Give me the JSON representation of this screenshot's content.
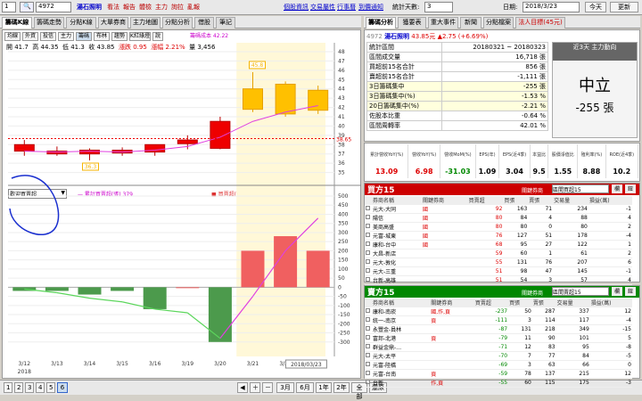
{
  "toolbar": {
    "period_value": "1",
    "stock_input": "4972",
    "stock_name": "湯石照明",
    "menu": [
      "看法",
      "報告",
      "體檢",
      "主力",
      "詢拉",
      "亂報"
    ],
    "links": [
      "個股資訊",
      "交易屬性",
      "行事曆",
      "到價通知"
    ],
    "stat_days_label": "統計天數:",
    "stat_days_value": "3",
    "date_label": "日期:",
    "date_value": "2018/3/23",
    "today_btn": "今天",
    "refresh_btn": "更新"
  },
  "left_tabs": [
    "籌碼K線",
    "籌碼走勢",
    "分點K線",
    "大單券商",
    "主力地圖",
    "分點分析",
    "借股",
    "筆記"
  ],
  "right_tabs": [
    "籌碼分析",
    "獲要表",
    "重大事件",
    "新聞",
    "分點檔案",
    "法人目標(45元)"
  ],
  "kline": {
    "buttons": [
      "均線",
      "外資",
      "投信",
      "主力",
      "籌碼",
      "布林",
      "趨勢",
      "K紅綠燈",
      "說"
    ],
    "cost_label": "籌碼成本 42.22",
    "ohlc": {
      "open": "開 41.7",
      "high": "高 44.35",
      "low": "低 41.3",
      "close": "收 43.85",
      "chg": "漲跌 0.95",
      "pct": "漲幅 2.21%",
      "vol": "量 3,456"
    },
    "price_label": "38.65",
    "tag_high": "45.8",
    "tag_low": "36.3"
  },
  "sub": {
    "selector": "歡迎買賣超",
    "legend1": "— 累計買賣超(張) 379",
    "legend2": "■ 買賣超(張) 255"
  },
  "chart_data": [
    {
      "type": "candlestick",
      "x": [
        "3/12",
        "3/13",
        "3/14",
        "3/15",
        "3/16",
        "3/19",
        "3/20",
        "3/21",
        "3/22",
        "3/23"
      ],
      "open": [
        38.0,
        37.3,
        37.0,
        37.4,
        37.2,
        38.1,
        40.5,
        44.0,
        44.5,
        41.7
      ],
      "high": [
        38.5,
        37.8,
        37.6,
        37.7,
        37.9,
        39.0,
        41.0,
        45.8,
        44.8,
        44.35
      ],
      "low": [
        36.8,
        36.8,
        36.3,
        36.8,
        36.8,
        37.5,
        37.5,
        41.5,
        41.0,
        41.3
      ],
      "close": [
        37.3,
        37.0,
        37.4,
        37.1,
        38.0,
        38.5,
        37.6,
        41.8,
        41.3,
        43.85
      ],
      "line": [
        37.3,
        37.2,
        37.3,
        37.2,
        37.4,
        37.8,
        38.8,
        40.5,
        41.5,
        42.2
      ],
      "ylim": [
        34,
        48
      ]
    },
    {
      "type": "bar",
      "x": [
        "3/12",
        "3/13",
        "3/14",
        "3/15",
        "3/16",
        "3/19",
        "3/20",
        "3/21",
        "3/22",
        "3/23"
      ],
      "values": [
        -20,
        -20,
        -40,
        -20,
        -120,
        0,
        -300,
        200,
        280,
        200
      ],
      "cumulative": [
        -10,
        -30,
        -60,
        -80,
        -120,
        -140,
        -280,
        -50,
        200,
        379
      ],
      "ylim": [
        -350,
        500
      ]
    }
  ],
  "xaxis": {
    "ticks": [
      "3/12",
      "3/13",
      "3/14",
      "3/15",
      "3/16",
      "3/19",
      "3/20",
      "3/21",
      "3/22"
    ],
    "sub": "2018",
    "cursor": "2018/03/23"
  },
  "kyticks": [
    "48",
    "47",
    "46",
    "45",
    "44",
    "43",
    "42",
    "41",
    "40",
    "39",
    "38",
    "37",
    "36",
    "35"
  ],
  "syticks": [
    "500",
    "450",
    "400",
    "350",
    "300",
    "250",
    "200",
    "150",
    "100",
    "50",
    "0",
    "-50",
    "-100",
    "-150",
    "-200",
    "-250",
    "-300"
  ],
  "bottom": {
    "pages": [
      "1",
      "2",
      "3",
      "4",
      "5",
      "6"
    ],
    "zoom": [
      "3月",
      "6月",
      "1年",
      "2年",
      "全部"
    ],
    "ok": "還原"
  },
  "stock": {
    "code": "4972",
    "name": "湯石照明",
    "price": "43.85元",
    "chg": "▲2.75 (+6.69%)"
  },
  "summary": {
    "rows": [
      [
        "統計區間",
        "20180321 ~ 20180323"
      ],
      [
        "區間成交量",
        "16,718 張"
      ],
      [
        "買超前15名合計",
        "856 張"
      ],
      [
        "賣超前15名合計",
        "-1,111 張"
      ],
      [
        "3日籌碼集中",
        "-255 張"
      ],
      [
        "3日籌碼集中(%)",
        "-1.53 %"
      ],
      [
        "20日籌碼集中(%)",
        "-2.21 %"
      ],
      [
        "佐股本比重",
        "-0.64 %"
      ],
      [
        "區間周轉率",
        "42.01 %"
      ]
    ],
    "side_title": "近3天 主力動向",
    "side_value": "中立",
    "side_num": "-255 張"
  },
  "stats": {
    "headers": [
      "累計營收YoY(%)",
      "營收YoY(%)",
      "營收MoM(%)",
      "EPS(年)",
      "EPS(近4季)",
      "本益比",
      "股價淨值比",
      "殖利率(%)",
      "ROE(近4季)"
    ],
    "values": [
      "13.09",
      "6.98",
      "-31.03",
      "1.09",
      "3.04",
      "9.5",
      "1.55",
      "8.88",
      "10.2"
    ]
  },
  "buy": {
    "title": "買方15",
    "filter": "關鍵券商",
    "select": "區間買超15",
    "btn1": "欄",
    "btn2": "鈕",
    "cols": [
      "券商名稱",
      "關鍵券商",
      "買賣超",
      "買張",
      "賣張",
      "交易量",
      "損益(萬)"
    ],
    "rows": [
      [
        "元大-大同",
        "國",
        "92",
        "163",
        "71",
        "234",
        "-1"
      ],
      [
        "陽信",
        "國",
        "80",
        "84",
        "4",
        "88",
        "4"
      ],
      [
        "美商高盛",
        "國",
        "80",
        "80",
        "0",
        "80",
        "2"
      ],
      [
        "元富-城東",
        "國",
        "76",
        "127",
        "51",
        "178",
        "-4"
      ],
      [
        "康和-台中",
        "國",
        "68",
        "95",
        "27",
        "122",
        "1"
      ],
      [
        "大昌-新店",
        "",
        "59",
        "60",
        "1",
        "61",
        "2"
      ],
      [
        "元大-敦化",
        "",
        "55",
        "131",
        "76",
        "207",
        "6"
      ],
      [
        "元大-三重",
        "",
        "51",
        "98",
        "47",
        "145",
        "-1"
      ],
      [
        "台新-高雄",
        "",
        "51",
        "54",
        "3",
        "57",
        "4"
      ]
    ]
  },
  "sell": {
    "title": "賣方15",
    "filter": "關鍵券商",
    "select": "區間賣超15",
    "btn1": "欄",
    "btn2": "鈕",
    "cols": [
      "券商名稱",
      "關鍵券商",
      "買賣超",
      "買張",
      "賣張",
      "交易量",
      "損益(萬)"
    ],
    "rows": [
      [
        "康和-南崁",
        "國,作,頁",
        "-237",
        "50",
        "287",
        "337",
        "12"
      ],
      [
        "統一-南京",
        "頁",
        "-111",
        "3",
        "114",
        "117",
        "-4"
      ],
      [
        "永豐金-員林",
        "",
        "-87",
        "131",
        "218",
        "349",
        "-15"
      ],
      [
        "富邦-北港",
        "頁",
        "-79",
        "11",
        "90",
        "101",
        "5"
      ],
      [
        "群益金鼎-…",
        "",
        "-71",
        "12",
        "83",
        "95",
        "-8"
      ],
      [
        "元大-太平",
        "",
        "-70",
        "7",
        "77",
        "84",
        "-5"
      ],
      [
        "元富-陸橋",
        "",
        "-69",
        "3",
        "63",
        "66",
        "0"
      ],
      [
        "元富-台南",
        "頁",
        "-59",
        "78",
        "137",
        "215",
        "12"
      ],
      [
        "台新",
        "作,頁",
        "-55",
        "60",
        "115",
        "175",
        "-3"
      ]
    ]
  }
}
